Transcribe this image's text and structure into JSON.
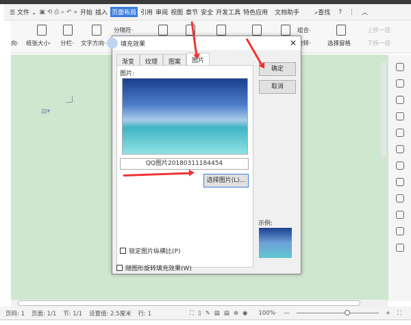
{
  "menubar": {
    "file": "文件",
    "tabs": [
      "开始",
      "插入",
      "页面布局",
      "引用",
      "审阅",
      "视图",
      "章节",
      "安全",
      "开发工具",
      "特色应用",
      "文档助手"
    ],
    "search": "查找"
  },
  "ribbon": {
    "orientation": "向·",
    "paper_size": "纸张大小·",
    "columns": "分栏·",
    "text_direction": "文字方向·",
    "breaks": "分隔符·",
    "group": "组合·",
    "rotate": "旋转·",
    "selection_pane": "选择窗格",
    "bring_forward": "上移一层·",
    "send_backward": "下移一层·"
  },
  "dialog": {
    "title": "填充效果",
    "tabs": [
      "渐变",
      "纹理",
      "图案",
      "图片"
    ],
    "picture_label": "图片:",
    "filename": "QQ图片20180311184454",
    "select_button": "选择图片(L)...",
    "lock_ratio": "锁定图片纵横比(P)",
    "rotate_with_shape": "随图形旋转填充效果(W)",
    "ok": "确定",
    "cancel": "取消",
    "sample_label": "示例:"
  },
  "status": {
    "page": "页码: 1",
    "pages": "页面: 1/1",
    "section": "节: 1/1",
    "setting": "设置值: 2.5厘米",
    "row": "行: 1",
    "zoom": "100%·"
  }
}
